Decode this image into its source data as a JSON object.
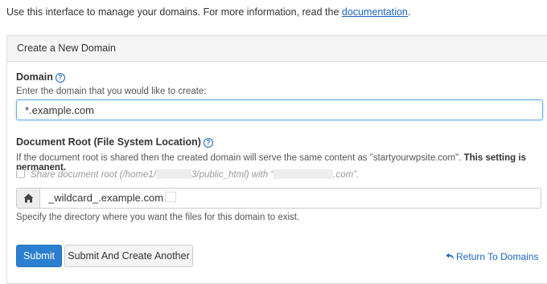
{
  "intro": {
    "text": "Use this interface to manage your domains. For more information, read the ",
    "link": "documentation",
    "suffix": "."
  },
  "panel": {
    "title": "Create a New Domain"
  },
  "domain": {
    "label": "Domain",
    "help_icon": "question-circle-icon",
    "hint": "Enter the domain that you would like to create:",
    "value": "*.example.com"
  },
  "document_root": {
    "label": "Document Root (File System Location)",
    "help_icon": "question-circle-icon",
    "hint_prefix": "If the document root is shared then the created domain will serve the same content as \"startyourwpsite.com\". ",
    "hint_bold": "This setting is permanent.",
    "share_label_a": "Share document root (/home1/",
    "share_label_b": "3/public_html) with “",
    "share_label_c": ".com”.",
    "share_checked": false,
    "home_icon": "home-icon",
    "value": "_wildcard_.example.com",
    "help_text": "Specify the directory where you want the files for this domain to exist."
  },
  "actions": {
    "submit": "Submit",
    "submit_another": "Submit And Create Another",
    "return_icon": "return-arrow-icon",
    "return_link": "Return To Domains"
  },
  "colors": {
    "primary": "#2b7fd0",
    "link": "#1a63c2",
    "focus_border": "#66afe9"
  }
}
